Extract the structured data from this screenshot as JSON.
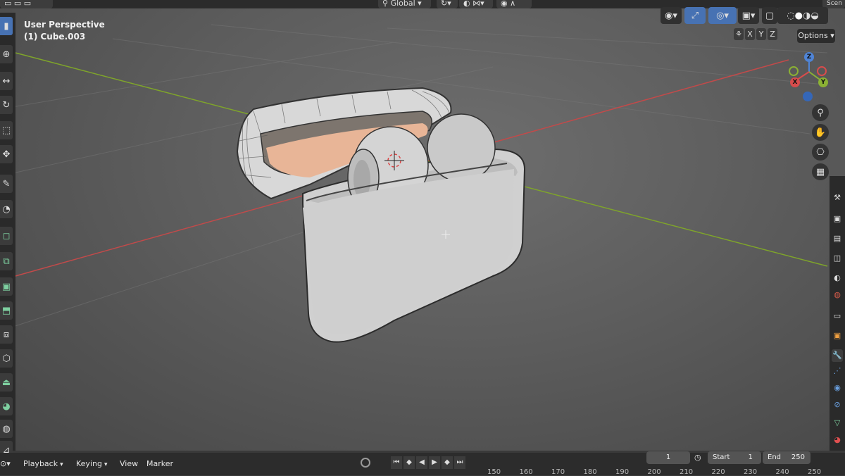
{
  "header": {
    "orientation_label": "Global",
    "options_label": "Options",
    "scene_label": "Scen",
    "axis_buttons": [
      "X",
      "Y",
      "Z"
    ]
  },
  "viewport": {
    "view_name": "User Perspective",
    "object_name": "(1) Cube.003"
  },
  "gizmo": {
    "z_label": "Z",
    "y_label": "Y",
    "x_label": "X"
  },
  "timeline": {
    "menus": [
      "Playback",
      "Keying",
      "View",
      "Marker"
    ],
    "current_frame": "1",
    "start_label": "Start",
    "start_value": "1",
    "end_label": "End",
    "end_value": "250",
    "ticks": [
      "150",
      "160",
      "170",
      "180",
      "190",
      "200",
      "210",
      "220",
      "230",
      "240",
      "250"
    ]
  },
  "colors": {
    "x_axis": "#c24a4a",
    "y_axis": "#7fa52a",
    "active_tool": "#4772b3",
    "case_interior": "#e8b597"
  }
}
